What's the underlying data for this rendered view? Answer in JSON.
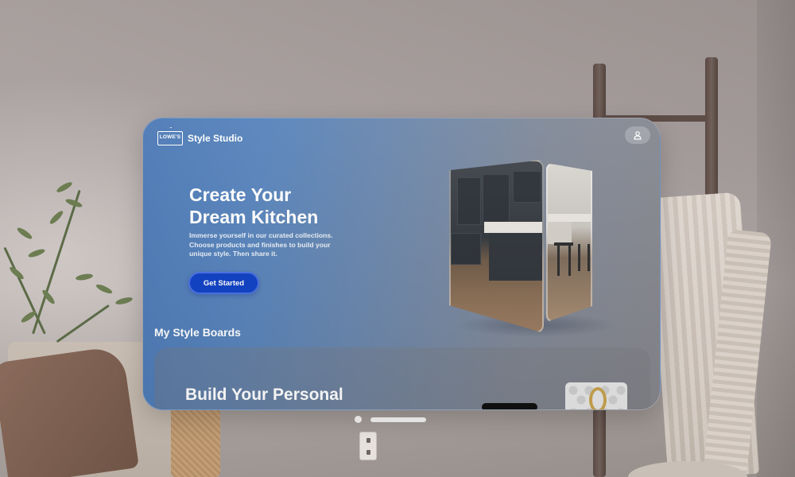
{
  "app": {
    "logo_text": "LOWE'S",
    "title": "Style Studio"
  },
  "hero": {
    "title_line1": "Create Your",
    "title_line2": "Dream Kitchen",
    "description": "Immerse yourself in our curated collections. Choose products and finishes to build your unique style. Then share it.",
    "cta_label": "Get Started"
  },
  "boards": {
    "section_title": "My Style Boards",
    "card_title": "Build Your Personal"
  },
  "icons": {
    "profile": "person-icon",
    "logo": "lowes-logo-icon"
  },
  "colors": {
    "cta_background": "#0d3fc4",
    "window_gradient_start": "#4a77b4",
    "window_gradient_end": "#86868c"
  }
}
